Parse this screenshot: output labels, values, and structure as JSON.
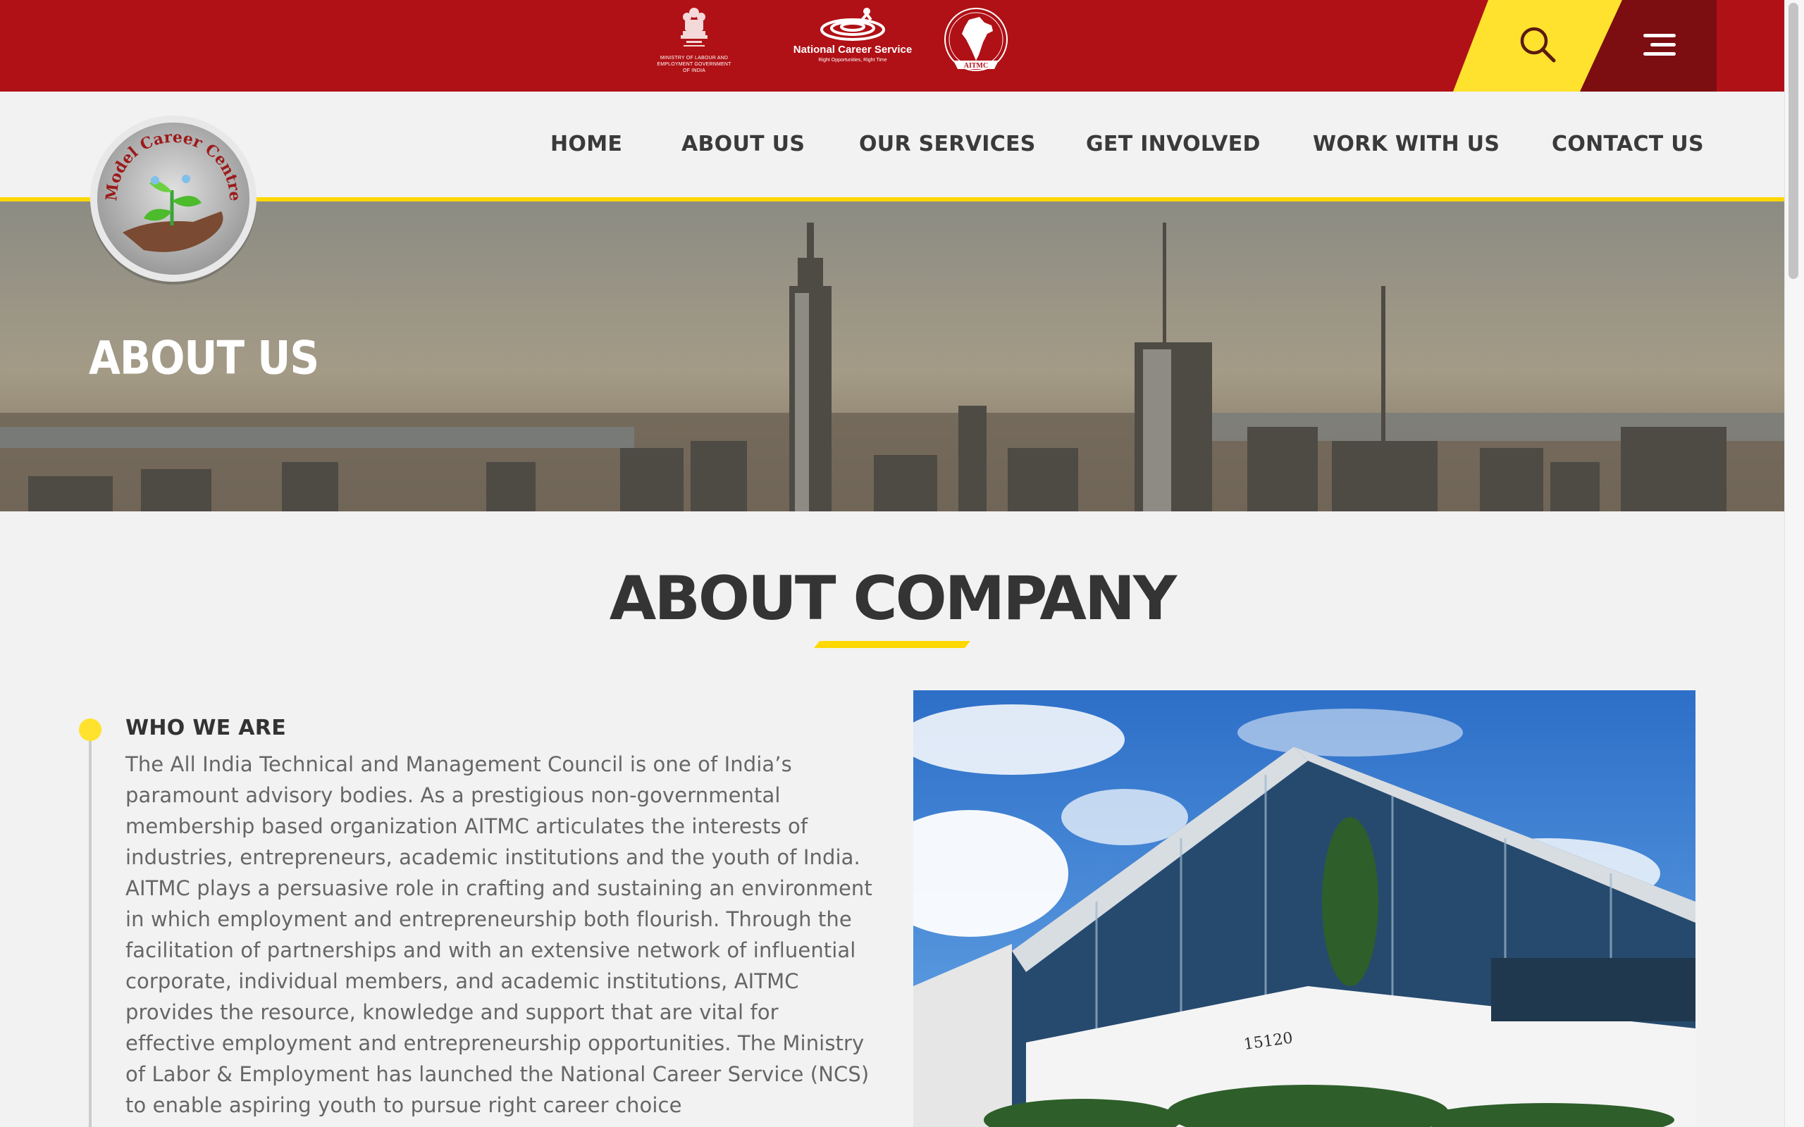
{
  "header": {
    "emblem_caption": "MINISTRY OF LABOUR AND EMPLOYMENT GOVERNMENT OF INDIA",
    "ncs_title": "National Career Service",
    "ncs_tagline": "Right Opportunities, Right Time",
    "aitmc_label": "AITMC"
  },
  "logo": {
    "text": "Model Career Centre"
  },
  "nav": {
    "items": [
      {
        "label": "HOME"
      },
      {
        "label": "ABOUT US"
      },
      {
        "label": "OUR SERVICES"
      },
      {
        "label": "GET INVOLVED"
      },
      {
        "label": "WORK WITH US"
      },
      {
        "label": "CONTACT US"
      }
    ]
  },
  "hero": {
    "title": "ABOUT US"
  },
  "main": {
    "heading": "ABOUT COMPANY",
    "section_title": "WHO WE ARE",
    "paragraph": "The All India Technical and Management Council is one of India’s paramount advisory bodies. As a prestigious non-governmental membership based organization AITMC articulates the interests of industries, entrepreneurs, academic institutions and the youth of India. AITMC plays a persuasive role in crafting and sustaining an environment in which employment and entrepreneurship both flourish. Through the facilitation of partnerships and with an extensive network of influential corporate, individual members, and academic institutions, AITMC provides the resource, knowledge and support that are vital for effective employment and entrepreneurship opportunities. The Ministry of Labor & Employment has launched the National Career Service (NCS) to enable aspiring youth to pursue right career choice",
    "building_number": "15120"
  },
  "colors": {
    "brand_red": "#b01116",
    "accent_yellow": "#ffe22e",
    "dark_red": "#7c0d11"
  },
  "icons": {
    "search": "search-icon",
    "menu": "hamburger-menu-icon"
  }
}
